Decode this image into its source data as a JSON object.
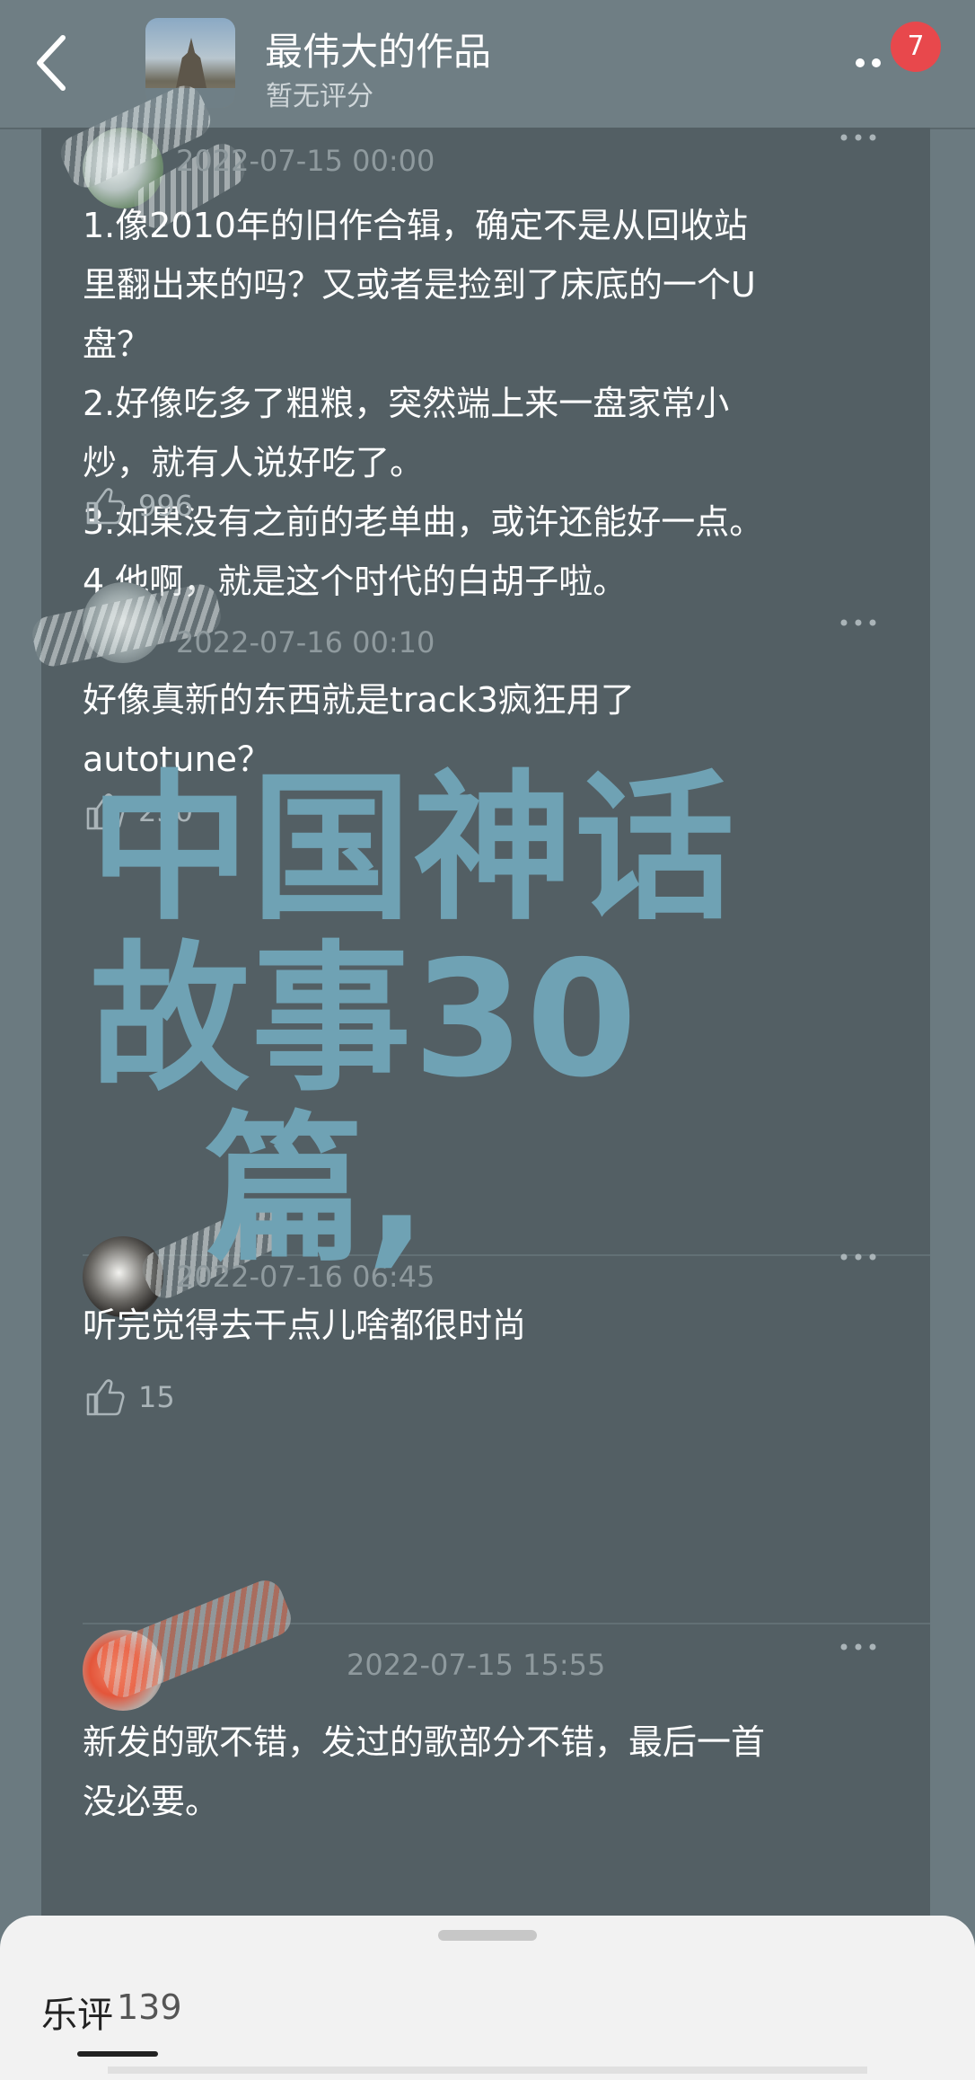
{
  "header": {
    "title": "最伟大的作品",
    "subtitle": "暂无评分",
    "badge_count": "7"
  },
  "comments": [
    {
      "date": "2022-07-15 00:00",
      "text": "1.像2010年的旧作合辑，确定不是从回收站\n里翻出来的吗？又或者是捡到了床底的一个U\n盘？\n2.好像吃多了粗粮，突然端上来一盘家常小\n炒，就有人说好吃了。\n3.如果没有之前的老单曲，或许还能好一点。\n4.他啊，就是这个时代的白胡子啦。",
      "likes": "996"
    },
    {
      "date": "2022-07-16 00:10",
      "text": "好像真新的东西就是track3疯狂用了\nautotune？",
      "likes": "250"
    },
    {
      "date": "2022-07-16 06:45",
      "text": "听完觉得去干点儿啥都很时尚",
      "likes": "15"
    },
    {
      "date": "2022-07-15 15:55",
      "text": "新发的歌不错，发过的歌部分不错，最后一首\n没必要。",
      "likes": ""
    }
  ],
  "watermark": {
    "text": "中国神话\n故事30\n  篇,"
  },
  "bottom_sheet": {
    "label": "乐评",
    "count": "139"
  }
}
